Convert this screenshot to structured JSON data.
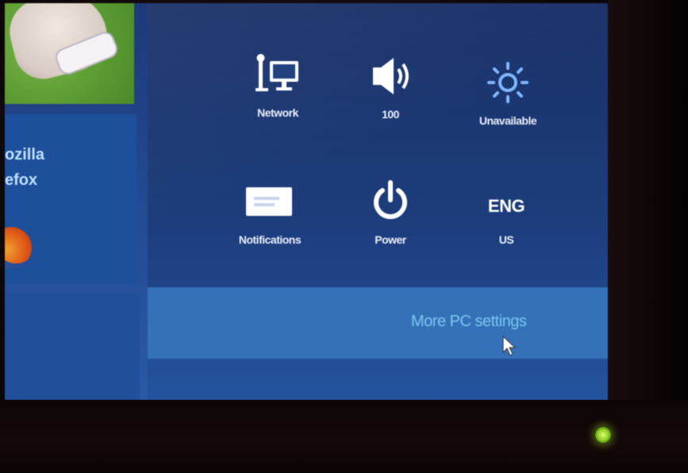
{
  "start_tiles": {
    "firefox_name": "ozilla\nefox"
  },
  "settings_pane": {
    "quick_settings": [
      {
        "label": "Network",
        "icon": "network-icon"
      },
      {
        "label": "100",
        "icon": "volume-icon"
      },
      {
        "label": "Unavailable",
        "icon": "brightness-icon"
      },
      {
        "label": "Notifications",
        "icon": "notifications-icon"
      },
      {
        "label": "Power",
        "icon": "power-icon"
      },
      {
        "label": "US",
        "icon": "keyboard-language-icon",
        "icon_text": "ENG"
      }
    ],
    "more_settings_label": "More PC settings"
  },
  "colors": {
    "pane_bg": "#1d3d7c",
    "more_bar_bg": "#3571b8",
    "link_color": "#78c8f2",
    "power_led": "#8ccc20"
  }
}
